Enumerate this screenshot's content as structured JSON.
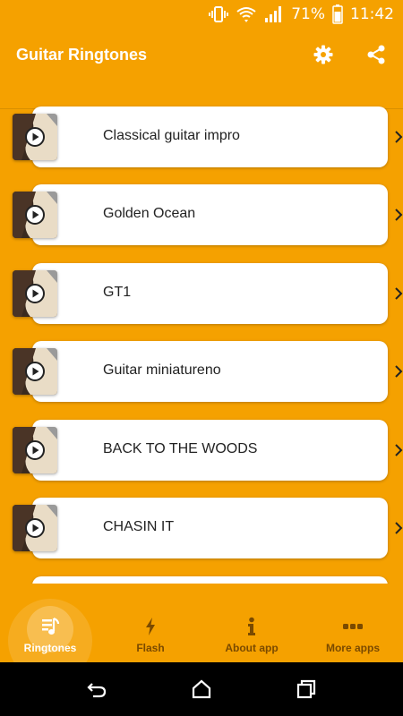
{
  "status_bar": {
    "battery": "71%",
    "time": "11:42",
    "icons": [
      "vibrate-icon",
      "wifi-icon",
      "signal-icon",
      "battery-icon"
    ]
  },
  "app_bar": {
    "title": "Guitar Ringtones",
    "actions": [
      "settings-icon",
      "share-icon"
    ]
  },
  "ringtones": [
    {
      "label": "Classical guitar impro"
    },
    {
      "label": "Golden Ocean"
    },
    {
      "label": "GT1"
    },
    {
      "label": "Guitar miniatureno"
    },
    {
      "label": "BACK TO THE WOODS"
    },
    {
      "label": "CHASIN IT"
    },
    {
      "label": ""
    }
  ],
  "bottom_nav": {
    "items": [
      {
        "label": "Ringtones",
        "icon": "ringtones-icon",
        "active": true
      },
      {
        "label": "Flash",
        "icon": "flash-icon",
        "active": false
      },
      {
        "label": "About app",
        "icon": "info-icon",
        "active": false
      },
      {
        "label": "More apps",
        "icon": "more-icon",
        "active": false
      }
    ]
  },
  "system_nav": [
    "back-icon",
    "home-icon",
    "recents-icon"
  ],
  "colors": {
    "primary": "#f5a100",
    "card": "#ffffff",
    "nav_inactive": "#7a4a00"
  }
}
